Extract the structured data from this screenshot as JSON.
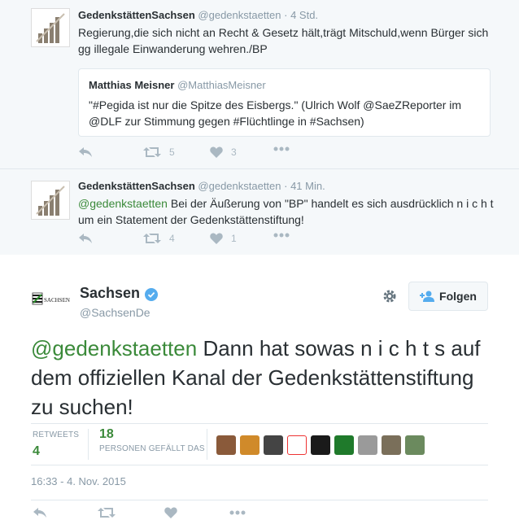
{
  "thread": [
    {
      "author_name": "GedenkstättenSachsen",
      "author_handle": "@gedenkstaetten",
      "time": "· 4 Std.",
      "text": "Regierung,die sich nicht an Recht & Gesetz hält,trägt Mitschuld,wenn Bürger sich gg illegale Einwanderung wehren./BP",
      "quote": {
        "author_name": "Matthias Meisner",
        "author_handle": "@MatthiasMeisner",
        "text": "\"#Pegida ist nur die Spitze des Eisbergs.\" (Ulrich Wolf @SaeZReporter im @DLF zur Stimmung gegen #Flüchtlinge in #Sachsen)"
      },
      "retweets": "5",
      "likes": "3"
    },
    {
      "author_name": "GedenkstättenSachsen",
      "author_handle": "@gedenkstaetten",
      "time": "· 41 Min.",
      "mention": "@gedenkstaetten",
      "text": " Bei der Äußerung von \"BP\" handelt es sich  ausdrücklich n i c h t  um ein Statement der Gedenkstättenstiftung!",
      "retweets": "4",
      "likes": "1"
    }
  ],
  "main": {
    "author_name": "Sachsen",
    "author_handle": "@SachsenDe",
    "avatar_text": "SACHSEN",
    "follow_label": "Folgen",
    "mention": "@gedenkstaetten",
    "text": " Dann hat sowas n i c h t s auf dem offiziellen Kanal der Gedenkstättenstiftung zu suchen!",
    "retweets_label": "RETWEETS",
    "retweets_value": "4",
    "likes_value": "18",
    "likes_label": "PERSONEN GEFÄLLT DAS",
    "timestamp": "16:33 - 4. Nov. 2015"
  },
  "colors": {
    "mention": "#3b8a3a",
    "muted": "#8899a6",
    "verified": "#55acee"
  },
  "icons": [
    "reply-icon",
    "retweet-icon",
    "heart-icon",
    "more-icon",
    "gear-icon",
    "add-user-icon",
    "verified-badge-icon"
  ]
}
